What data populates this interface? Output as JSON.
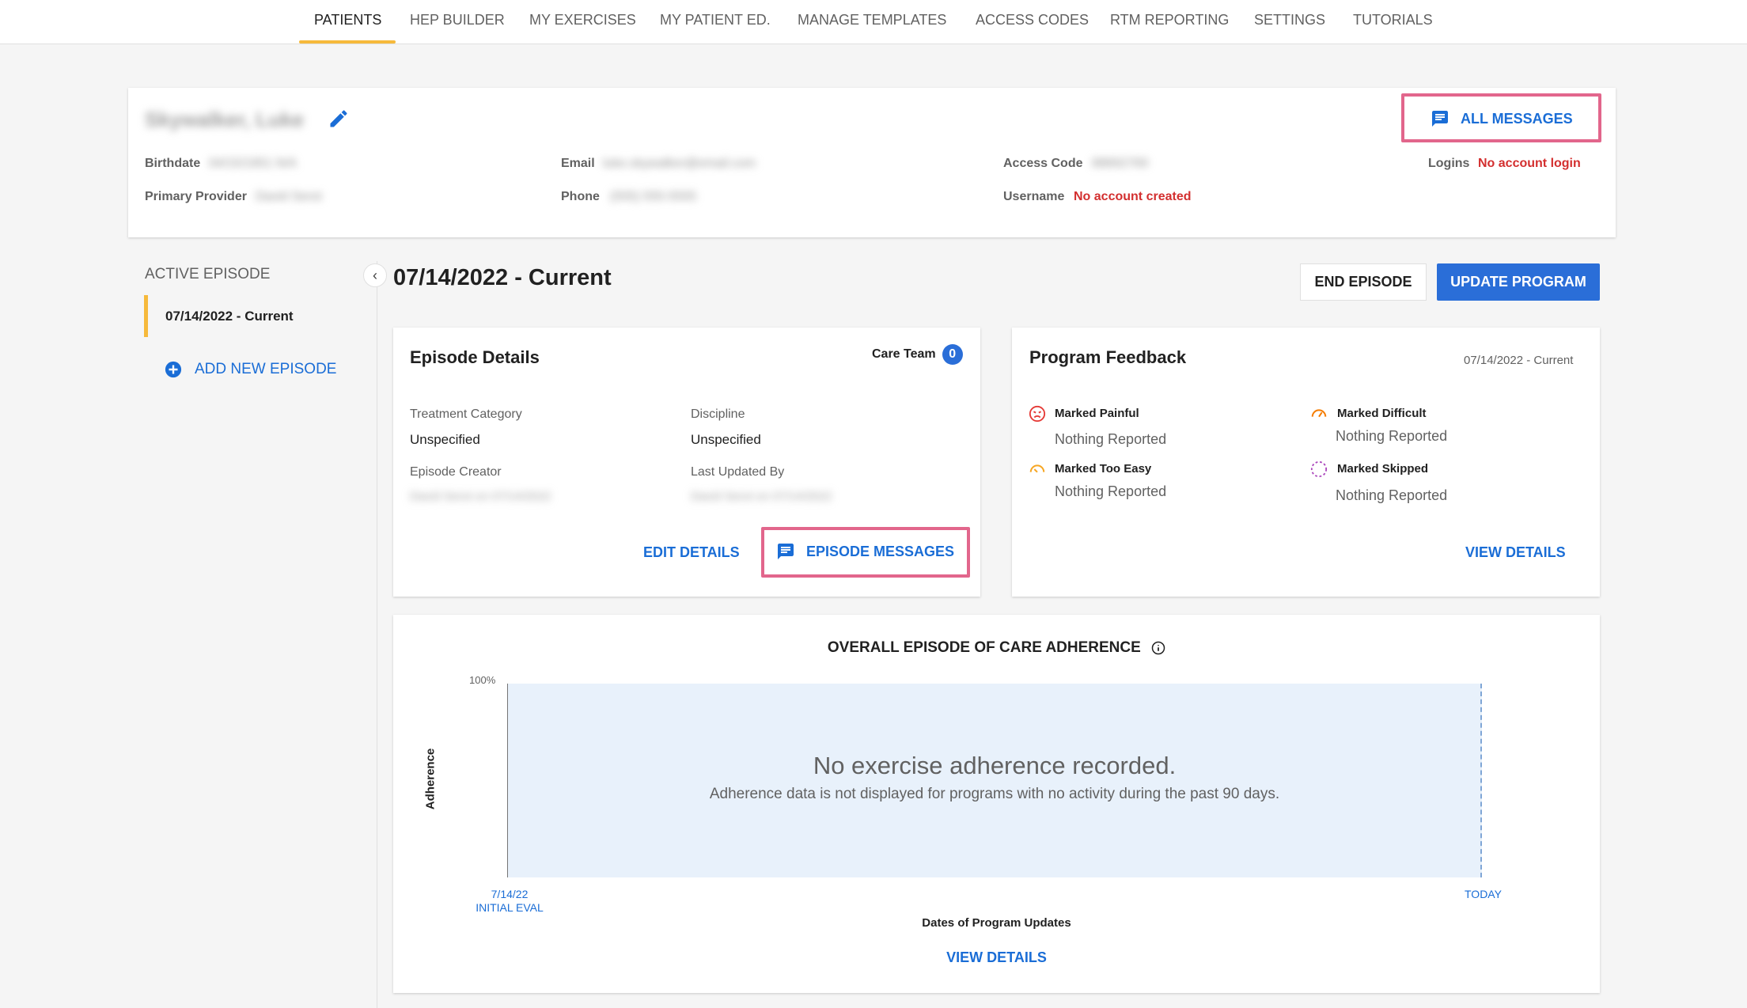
{
  "nav": {
    "tabs": [
      {
        "label": "PATIENTS",
        "active": true
      },
      {
        "label": "HEP BUILDER"
      },
      {
        "label": "MY EXERCISES"
      },
      {
        "label": "MY PATIENT ED."
      },
      {
        "label": "MANAGE TEMPLATES"
      },
      {
        "label": "ACCESS CODES"
      },
      {
        "label": "RTM REPORTING"
      },
      {
        "label": "SETTINGS"
      },
      {
        "label": "TUTORIALS"
      }
    ]
  },
  "patient": {
    "name": "Skywalker, Luke",
    "birthdate_label": "Birthdate",
    "birthdate_value": "04/15/1951 N/A",
    "primary_provider_label": "Primary Provider",
    "primary_provider_value": "David Serot",
    "email_label": "Email",
    "email_value": "luke.skywalker@email.com",
    "phone_label": "Phone",
    "phone_value": "(555) 555-5555",
    "access_code_label": "Access Code",
    "access_code_value": "88892769",
    "username_label": "Username",
    "username_value": "No account created",
    "logins_label": "Logins",
    "logins_value": "No account login",
    "all_messages_label": "ALL MESSAGES"
  },
  "sidebar": {
    "title": "ACTIVE EPISODE",
    "episode_label": "07/14/2022 - Current",
    "add_episode_label": "ADD NEW EPISODE"
  },
  "episode": {
    "title": "07/14/2022 - Current",
    "end_button": "END EPISODE",
    "update_button": "UPDATE PROGRAM"
  },
  "episode_details": {
    "title": "Episode Details",
    "care_team_label": "Care Team",
    "care_team_count": "0",
    "treatment_category_label": "Treatment Category",
    "treatment_category_value": "Unspecified",
    "discipline_label": "Discipline",
    "discipline_value": "Unspecified",
    "episode_creator_label": "Episode Creator",
    "episode_creator_value": "David Serot on 07/14/2022",
    "last_updated_label": "Last Updated By",
    "last_updated_value": "David Serot on 07/14/2022",
    "edit_label": "EDIT DETAILS",
    "messages_label": "EPISODE MESSAGES"
  },
  "feedback": {
    "title": "Program Feedback",
    "date": "07/14/2022 - Current",
    "painful_label": "Marked Painful",
    "painful_value": "Nothing Reported",
    "difficult_label": "Marked Difficult",
    "difficult_value": "Nothing Reported",
    "too_easy_label": "Marked Too Easy",
    "too_easy_value": "Nothing Reported",
    "skipped_label": "Marked Skipped",
    "skipped_value": "Nothing Reported",
    "view_details_label": "VIEW DETAILS",
    "colors": {
      "painful": "#e53935",
      "difficult": "#f57c00",
      "too_easy": "#f6a623",
      "skipped": "#ab47bc"
    }
  },
  "adherence": {
    "title": "OVERALL EPISODE OF CARE ADHERENCE",
    "y_tick": "100%",
    "y_label": "Adherence",
    "x_start_date": "7/14/22",
    "x_start_label": "INITIAL EVAL",
    "x_end_label": "TODAY",
    "x_axis_label": "Dates of Program Updates",
    "empty_title": "No exercise adherence recorded.",
    "empty_sub": "Adherence data is not displayed for programs with no activity during the past 90 days.",
    "view_details_label": "VIEW DETAILS"
  }
}
